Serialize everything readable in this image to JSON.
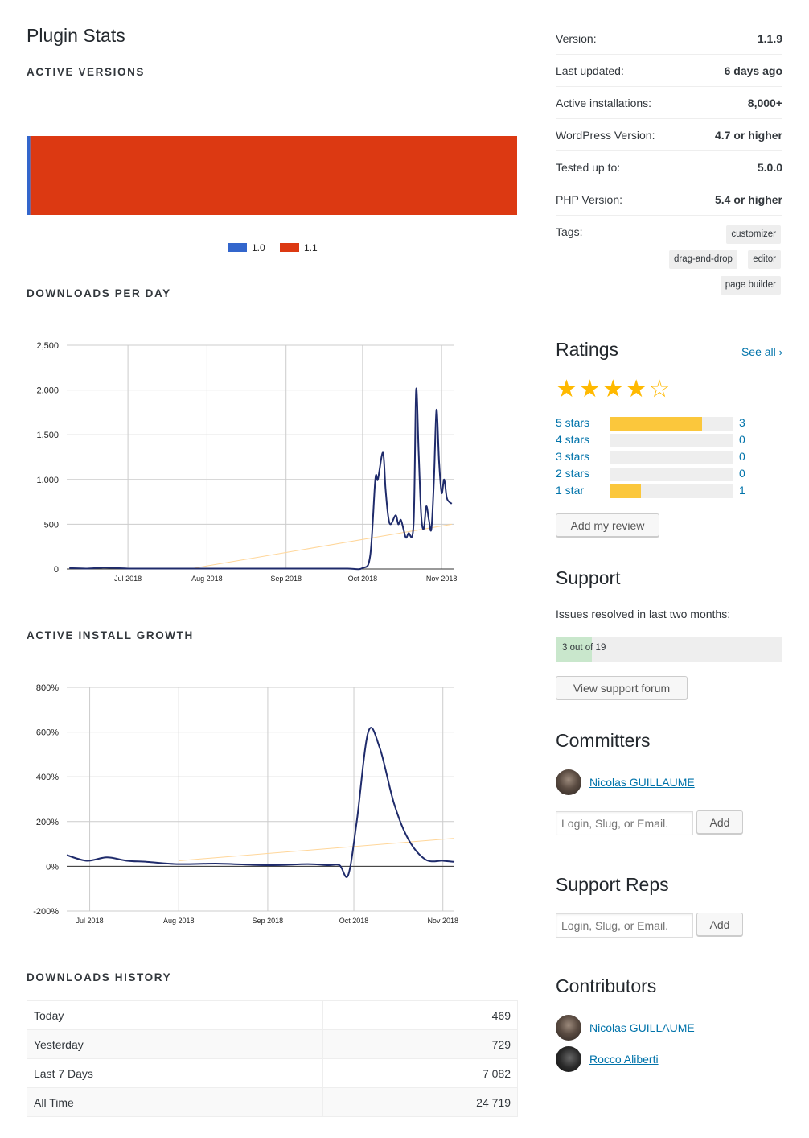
{
  "page_title": "Plugin Stats",
  "sections": {
    "active_versions": "ACTIVE VERSIONS",
    "downloads_per_day": "DOWNLOADS PER DAY",
    "active_install_growth": "ACTIVE INSTALL GROWTH",
    "downloads_history": "DOWNLOADS HISTORY"
  },
  "chart_data": [
    {
      "type": "bar",
      "orientation": "horizontal",
      "stacked": true,
      "title": "",
      "series": [
        {
          "name": "1.0",
          "values": [
            0.6
          ],
          "color": "#3366cc"
        },
        {
          "name": "1.1",
          "values": [
            99.4
          ],
          "color": "#dc3912"
        }
      ],
      "legend": [
        "1.0",
        "1.1"
      ],
      "legend_position": "bottom"
    },
    {
      "type": "line",
      "title": "",
      "x_ticks": [
        "Jul 2018",
        "Aug 2018",
        "Sep 2018",
        "Oct 2018",
        "Nov 2018"
      ],
      "y_ticks": [
        "0",
        "500",
        "1,000",
        "1,500",
        "2,000",
        "2,500"
      ],
      "ylim": [
        0,
        2500
      ],
      "x": [
        "2018-06-08",
        "2018-06-15",
        "2018-06-22",
        "2018-07-01",
        "2018-07-15",
        "2018-08-01",
        "2018-08-15",
        "2018-09-01",
        "2018-09-15",
        "2018-09-25",
        "2018-10-01",
        "2018-10-04",
        "2018-10-06",
        "2018-10-07",
        "2018-10-09",
        "2018-10-10",
        "2018-10-11",
        "2018-10-12",
        "2018-10-14",
        "2018-10-15",
        "2018-10-16",
        "2018-10-17",
        "2018-10-18",
        "2018-10-19",
        "2018-10-21",
        "2018-10-22",
        "2018-10-23",
        "2018-10-24",
        "2018-10-25",
        "2018-10-26",
        "2018-10-27",
        "2018-10-28",
        "2018-10-29",
        "2018-10-30",
        "2018-10-31",
        "2018-11-01",
        "2018-11-02",
        "2018-11-03",
        "2018-11-04",
        "2018-11-05"
      ],
      "values": [
        10,
        5,
        15,
        5,
        5,
        5,
        5,
        5,
        5,
        5,
        10,
        150,
        1000,
        1000,
        1300,
        900,
        600,
        500,
        600,
        500,
        550,
        450,
        350,
        400,
        500,
        2000,
        1300,
        600,
        450,
        700,
        550,
        450,
        1000,
        1780,
        1200,
        850,
        1000,
        800,
        750,
        730
      ],
      "trendline": {
        "from": [
          "2018-07-25",
          0
        ],
        "to": [
          "2018-11-05",
          500
        ],
        "color": "#ffd699"
      },
      "line_color": "#1f2b6b"
    },
    {
      "type": "line",
      "title": "",
      "x_ticks": [
        "Jul 2018",
        "Aug 2018",
        "Sep 2018",
        "Oct 2018",
        "Nov 2018"
      ],
      "y_ticks": [
        "-200%",
        "0%",
        "200%",
        "400%",
        "600%",
        "800%"
      ],
      "ylim": [
        -200,
        800
      ],
      "x": [
        "2018-06-23",
        "2018-06-30",
        "2018-07-07",
        "2018-07-14",
        "2018-07-21",
        "2018-08-01",
        "2018-08-15",
        "2018-09-01",
        "2018-09-15",
        "2018-09-22",
        "2018-09-26",
        "2018-09-29",
        "2018-10-02",
        "2018-10-06",
        "2018-10-10",
        "2018-10-15",
        "2018-10-20",
        "2018-10-26",
        "2018-11-01",
        "2018-11-05"
      ],
      "values": [
        50,
        25,
        40,
        25,
        20,
        10,
        12,
        5,
        10,
        5,
        5,
        -40,
        200,
        600,
        530,
        280,
        120,
        30,
        25,
        20
      ],
      "trendline": {
        "from": [
          "2018-08-01",
          25
        ],
        "to": [
          "2018-11-05",
          125
        ],
        "color": "#ffd699"
      },
      "line_color": "#1f2b6b"
    }
  ],
  "downloads_history": [
    {
      "label": "Today",
      "value": "469"
    },
    {
      "label": "Yesterday",
      "value": "729"
    },
    {
      "label": "Last 7 Days",
      "value": "7 082"
    },
    {
      "label": "All Time",
      "value": "24 719"
    }
  ],
  "meta": [
    {
      "label": "Version:",
      "value": "1.1.9"
    },
    {
      "label": "Last updated:",
      "value": "6 days ago"
    },
    {
      "label": "Active installations:",
      "value": "8,000+"
    },
    {
      "label": "WordPress Version:",
      "value": "4.7 or higher"
    },
    {
      "label": "Tested up to:",
      "value": "5.0.0"
    },
    {
      "label": "PHP Version:",
      "value": "5.4 or higher"
    }
  ],
  "tags_label": "Tags:",
  "tags": [
    "customizer",
    "drag-and-drop",
    "editor",
    "page builder"
  ],
  "ratings": {
    "heading": "Ratings",
    "see_all": "See all",
    "average_stars": 4,
    "rows": [
      {
        "label": "5 stars",
        "count": "3",
        "fraction": 0.75
      },
      {
        "label": "4 stars",
        "count": "0",
        "fraction": 0
      },
      {
        "label": "3 stars",
        "count": "0",
        "fraction": 0
      },
      {
        "label": "2 stars",
        "count": "0",
        "fraction": 0
      },
      {
        "label": "1 star",
        "count": "1",
        "fraction": 0.25
      }
    ],
    "add_review": "Add my review"
  },
  "support": {
    "heading": "Support",
    "resolved_text": "Issues resolved in last two months:",
    "resolved_label": "3 out of 19",
    "resolved_fraction": 0.158,
    "view_forum": "View support forum"
  },
  "committers": {
    "heading": "Committers",
    "people": [
      "Nicolas GUILLAUME "
    ],
    "input_placeholder": "Login, Slug, or Email.",
    "add": "Add"
  },
  "support_reps": {
    "heading": "Support Reps",
    "input_placeholder": "Login, Slug, or Email.",
    "add": "Add"
  },
  "contributors": {
    "heading": "Contributors",
    "people": [
      "Nicolas GUILLAUME",
      "Rocco Aliberti"
    ]
  },
  "colors": {
    "link": "#0073aa",
    "star": "#ffb900",
    "resolved": "#c9e7cc"
  }
}
